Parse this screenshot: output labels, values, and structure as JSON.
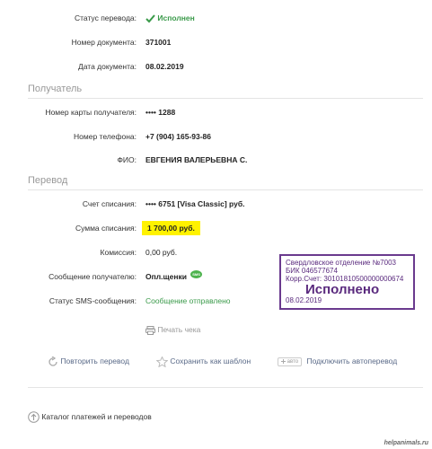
{
  "details": {
    "status_label": "Статус перевода:",
    "status_value": "Исполнен",
    "doc_num_label": "Номер документа:",
    "doc_num_value": "371001",
    "doc_date_label": "Дата документа:",
    "doc_date_value": "08.02.2019"
  },
  "recipient": {
    "heading": "Получатель",
    "card_label": "Номер карты получателя:",
    "card_value": "•••• 1288",
    "phone_label": "Номер телефона:",
    "phone_value": "+7 (904) 165-93-86",
    "name_label": "ФИО:",
    "name_value": "ЕВГЕНИЯ ВАЛЕРЬЕВНА С."
  },
  "transfer": {
    "heading": "Перевод",
    "account_label": "Счет списания:",
    "account_value": "•••• 6751  [Visa Classic]  руб.",
    "amount_label": "Сумма списания:",
    "amount_value": "1 700,00  руб.",
    "fee_label": "Комиссия:",
    "fee_value": "0,00 руб.",
    "message_label": "Сообщение получателю:",
    "message_value": "Опл.щенки",
    "sms_label": "Статус SMS-сообщения:",
    "sms_value": "Сообщение отправлено",
    "print_label": "Печать чека"
  },
  "actions": {
    "repeat": "Повторить перевод",
    "template": "Сохранить как шаблон",
    "auto_tag": "авто",
    "auto": "Подключить автоперевод"
  },
  "footer": {
    "catalog": "Каталог платежей и переводов"
  },
  "stamp": {
    "line1": "Свердловское отделение №7003",
    "line2": "БИК 046577674",
    "line3": "Корр.Счет: 30101810500000000674",
    "big": "Исполнено",
    "date": "08.02.2019"
  },
  "watermark": "helpanimals.ru",
  "colors": {
    "accent_green": "#3a9a4a",
    "highlight": "#fff200",
    "link": "#5a6a88",
    "stamp": "#6a3a8e"
  }
}
